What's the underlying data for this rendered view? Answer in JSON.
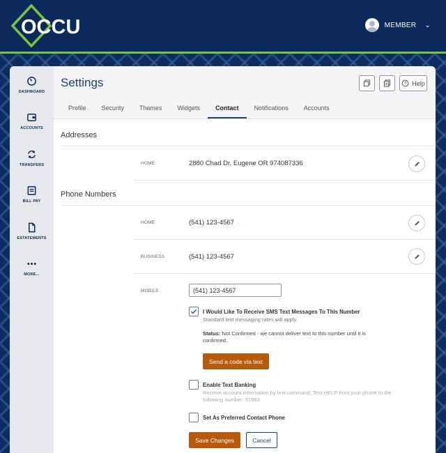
{
  "header": {
    "logo_text": "OCCU",
    "member_label": "MEMBER"
  },
  "nav": {
    "items": [
      {
        "label": "DASHBOARD",
        "icon": "speedometer-icon"
      },
      {
        "label": "ACCOUNTS",
        "icon": "wallet-icon"
      },
      {
        "label": "TRANSFERS",
        "icon": "transfer-arrows-icon"
      },
      {
        "label": "BILL PAY",
        "icon": "bill-pay-icon"
      },
      {
        "label": "ESTATEMENTS",
        "icon": "document-icon"
      },
      {
        "label": "MORE...",
        "icon": "more-dots-icon"
      }
    ]
  },
  "page": {
    "title": "Settings",
    "help_label": "Help",
    "tabs": [
      "Profile",
      "Security",
      "Themes",
      "Widgets",
      "Contact",
      "Notifications",
      "Accounts"
    ],
    "active_tab": "Contact"
  },
  "addresses": {
    "title": "Addresses",
    "rows": [
      {
        "label": "HOME",
        "value": "2880 Chad Dr, Eugene OR 974087336"
      }
    ]
  },
  "phones": {
    "title": "Phone Numbers",
    "rows": [
      {
        "label": "HOME",
        "value": "(541) 123-4567",
        "faint": "......"
      },
      {
        "label": "BUSINESS",
        "value": "(541) 123-4567"
      }
    ],
    "mobile": {
      "label": "MOBILE",
      "value": "(541) 123-4567"
    }
  },
  "sms": {
    "checked": true,
    "title": "I Would Like To Receive SMS Text Messages To This Number",
    "subtitle": "Standard text messaging rates will apply.",
    "status_label": "Status:",
    "status_text": " Not Confirmed - we cannot deliver text to this number until it is confirmed.",
    "send_code_label": "Send a code via text"
  },
  "text_banking": {
    "checked": false,
    "title": "Enable Text Banking",
    "subtitle": "Receive account information by text command. Text HELP from your phone to the following number: 91983"
  },
  "preferred": {
    "checked": false,
    "title": "Set As Preferred Contact Phone"
  },
  "actions": {
    "save_label": "Save Changes",
    "cancel_label": "Cancel"
  },
  "colors": {
    "navy": "#0b2a5b",
    "accent_green": "#7cc242",
    "button_orange": "#b8590c"
  }
}
